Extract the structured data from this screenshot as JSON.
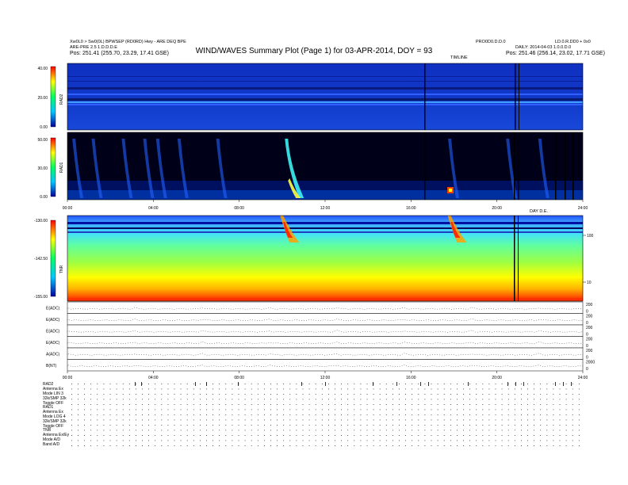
{
  "header": {
    "title": "WIND/WAVES Summary Plot (Page 1) for 03-APR-2014, DOY = 93",
    "left_line1": "Xw0L0 > Sw0(0L) BPWSEP (RD0RD) Hwy - ARE DEQ BPE",
    "left_line2": "ARE-PRE 2.5 1.D.D.D.E",
    "left_pos_label": "Pos:",
    "left_pos_value": "251.41 (255.70, 23.29, 17.41 GSE)",
    "right_line1a": "PRO0D0.D.D.0",
    "right_line1b": "LD.0.R.DD0 + 0x0",
    "right_line2": "DAILY: 2014-04-03 1.0.0.D.0",
    "right_pos_label": "Pos:",
    "right_pos_value": "251.46 (256.14, 23.02, 17.71 GSE)",
    "mid_label": "TIMLINE",
    "tnr_top_label": "DAY D.E."
  },
  "panels": {
    "rad2": {
      "name": "RAD2",
      "ticks": [
        "40.00",
        "20.00",
        "0.00"
      ]
    },
    "rad1": {
      "name": "RAD1",
      "ticks": [
        "50.00",
        "30.00",
        "0.00"
      ]
    },
    "tnr": {
      "name": "TNR",
      "ticks": [
        "-130.00",
        "-142.50",
        "-155.00"
      ],
      "right_ticks": [
        "100",
        "10"
      ]
    }
  },
  "time_ticks": [
    "00:00",
    "04:00",
    "08:00",
    "12:00",
    "16:00",
    "20:00",
    "24:00"
  ],
  "line_panels": [
    {
      "label": "E(ADC)",
      "right_ticks": [
        "200",
        "0"
      ]
    },
    {
      "label": "E(ADC)",
      "right_ticks": [
        "200",
        "0"
      ]
    },
    {
      "label": "E(ADC)",
      "right_ticks": [
        "200",
        "0"
      ]
    },
    {
      "label": "E(ADC)",
      "right_ticks": [
        "200",
        "0"
      ]
    },
    {
      "label": "A(ADC)",
      "right_ticks": [
        "200",
        "0"
      ]
    },
    {
      "label": "B(NT)",
      "right_ticks": [
        "2000",
        "0"
      ]
    }
  ],
  "footer": {
    "rad2_block": [
      "RAD2",
      "Antenna   Ex",
      "Mode   LIN 3",
      "32k/SMP   32k",
      "Toggle   OFF"
    ],
    "rad1_block": [
      "RAD1",
      "Antenna   Ex",
      "Mode   LOG 4",
      "32k/SMP   32k",
      "Toggle   OFF"
    ],
    "tnr_block": [
      "TNR",
      "Antenna   Ex/Ey",
      "Mode   A/D",
      "Band   A/D"
    ]
  },
  "colors": {
    "bg_blue": "#1038c8",
    "rad1_bg": "#000010",
    "colorbar": [
      "#ff0000",
      "#ffff00",
      "#00ff60",
      "#00c8ff",
      "#0000a0"
    ]
  },
  "chart_data": [
    {
      "type": "heatmap",
      "name": "RAD2",
      "x": "time (hours)",
      "xlim": [
        0,
        24
      ],
      "ylim": [
        0,
        40
      ],
      "ticks": [
        0,
        20,
        40
      ],
      "features": [
        "bright horizontal bands near 22 and 13",
        "mostly uniform blue background"
      ]
    },
    {
      "type": "heatmap",
      "name": "RAD1",
      "xlim": [
        0,
        24
      ],
      "ylim": [
        0,
        50
      ],
      "ticks": [
        0,
        30,
        50
      ],
      "bursts_hours": [
        0.3,
        1.2,
        2.6,
        3.6,
        4.2,
        5.2,
        7.0,
        10.2,
        17.8,
        20.5,
        22.0
      ]
    },
    {
      "type": "heatmap",
      "name": "TNR",
      "xlim": [
        0,
        24
      ],
      "ylim": [
        -155,
        -130
      ],
      "ticks": [
        -155,
        -142.5,
        -130
      ],
      "bursts_hours": [
        10.2,
        18.0
      ]
    }
  ]
}
